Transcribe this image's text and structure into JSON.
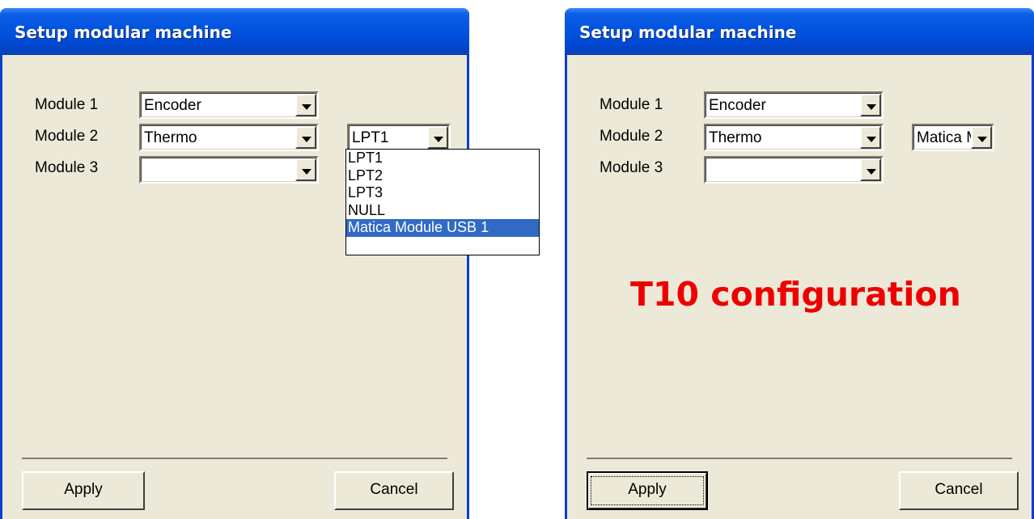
{
  "left_window": {
    "title": "Setup modular machine",
    "modules": [
      {
        "label": "Module 1",
        "value": "Encoder"
      },
      {
        "label": "Module 2",
        "value": "Thermo"
      },
      {
        "label": "Module 3",
        "value": ""
      }
    ],
    "port_combo_value": "LPT1",
    "dropdown_options": [
      "LPT1",
      "LPT2",
      "LPT3",
      "NULL",
      "Matica Module USB 1"
    ],
    "dropdown_selected": "Matica Module USB 1",
    "apply_label": "Apply",
    "cancel_label": "Cancel"
  },
  "right_window": {
    "title": "Setup modular machine",
    "modules": [
      {
        "label": "Module 1",
        "value": "Encoder"
      },
      {
        "label": "Module 2",
        "value": "Thermo"
      },
      {
        "label": "Module 3",
        "value": ""
      }
    ],
    "port_combo_value": "Matica M",
    "caption": "T10 configuration",
    "apply_label": "Apply",
    "cancel_label": "Cancel"
  },
  "colors": {
    "title_bar": "#0355e0",
    "dialog_bg": "#ece9d8",
    "selection": "#316ac5",
    "caption": "#ee0000"
  }
}
